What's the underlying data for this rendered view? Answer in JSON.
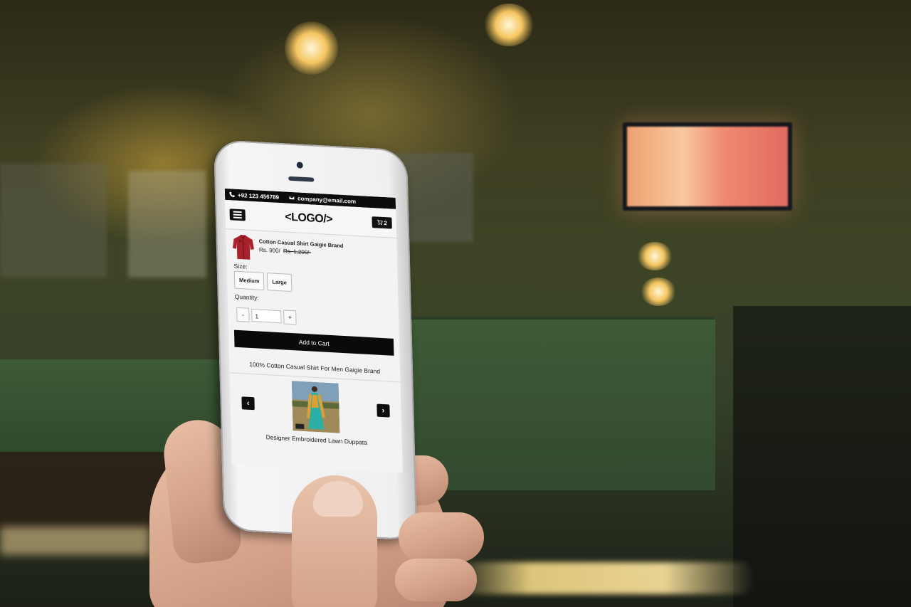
{
  "topbar": {
    "phone_icon": "phone-icon",
    "phone": "+92 123 456789",
    "email_icon": "envelope-icon",
    "email": "company@email.com"
  },
  "header": {
    "menu_icon": "hamburger-menu-icon",
    "logo": "<LOGO/>",
    "cart_icon": "shopping-cart-icon",
    "cart_count": "2"
  },
  "product": {
    "name": "Cotton Casual Shirt Gaigie Brand",
    "price": "Rs. 900/",
    "old_price": "Rs. 1,200/-",
    "size_label": "Size:",
    "sizes": [
      "Medium",
      "Large"
    ],
    "quantity_label": "Quantity:",
    "qty_minus": "-",
    "qty_value": "1",
    "qty_plus": "+",
    "add_to_cart": "Add to Cart",
    "description": "100% Cotton Casual Shirt For Men Gaigie Brand"
  },
  "related": {
    "prev_icon": "chevron-left-icon",
    "prev_glyph": "‹",
    "next_icon": "chevron-right-icon",
    "next_glyph": "›",
    "item_name": "Designer Embroidered Lawn Duppata"
  },
  "colors": {
    "topbar_bg": "#0c0c0c",
    "button_bg": "#0a0a0a",
    "screen_bg": "#f3f3f3",
    "shirt": "#a8202a"
  }
}
